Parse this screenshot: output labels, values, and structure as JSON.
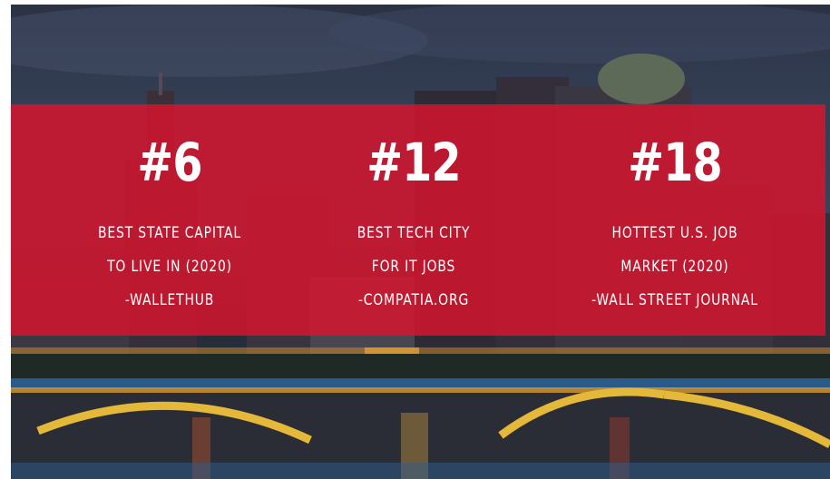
{
  "stats": [
    {
      "rank": "#6",
      "lines": [
        "Best State Capital",
        "to Live In (2020)",
        "-WalletHub"
      ]
    },
    {
      "rank": "#12",
      "lines": [
        "Best Tech City",
        "for IT Jobs",
        "-CompaTIA.org"
      ]
    },
    {
      "rank": "#18",
      "lines": [
        "Hottest U.S. Job",
        "Market (2020)",
        "-Wall Street Journal"
      ]
    }
  ],
  "colors": {
    "band": "#d7142d",
    "text": "#ffffff"
  }
}
